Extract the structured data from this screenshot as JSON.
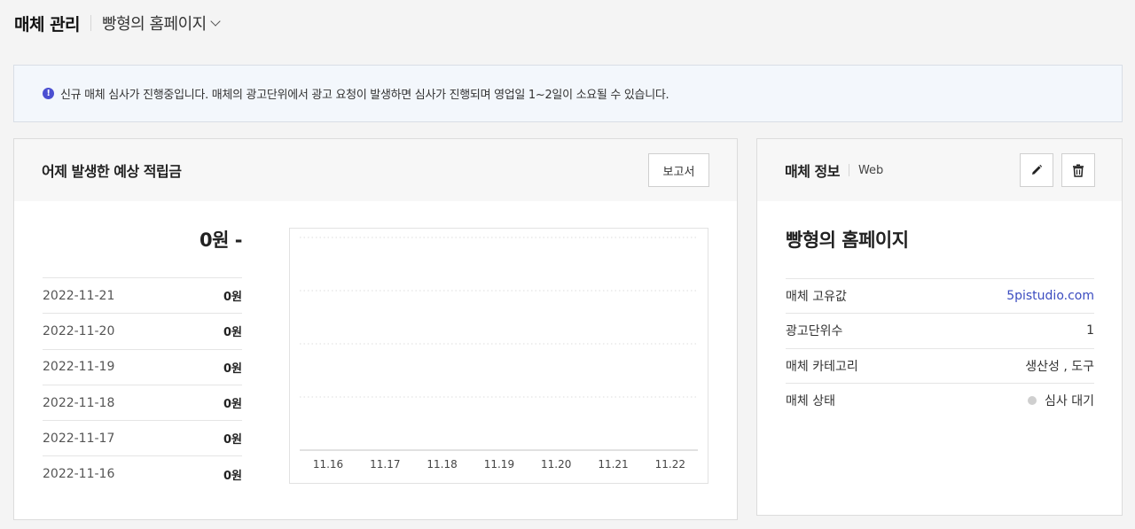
{
  "header": {
    "title": "매체 관리",
    "media_selector": "빵형의 홈페이지"
  },
  "notice": {
    "icon": "exclamation-circle-icon",
    "text": "신규 매체 심사가 진행중입니다. 매체의 광고단위에서 광고 요청이 발생하면 심사가 진행되며 영업일 1~2일이 소요될 수 있습니다.",
    "icon_color": "#4b4fd1"
  },
  "earnings": {
    "title": "어제 발생한 예상 적립금",
    "report_button": "보고서",
    "total": "0원 -",
    "days": [
      {
        "date": "2022-11-21",
        "amount": "0원"
      },
      {
        "date": "2022-11-20",
        "amount": "0원"
      },
      {
        "date": "2022-11-19",
        "amount": "0원"
      },
      {
        "date": "2022-11-18",
        "amount": "0원"
      },
      {
        "date": "2022-11-17",
        "amount": "0원"
      },
      {
        "date": "2022-11-16",
        "amount": "0원"
      }
    ]
  },
  "chart_data": {
    "type": "line",
    "title": "",
    "x": [
      "11.16",
      "11.17",
      "11.18",
      "11.19",
      "11.20",
      "11.21",
      "11.22"
    ],
    "series": [
      {
        "values": [
          0,
          0,
          0,
          0,
          0,
          0,
          0
        ]
      }
    ],
    "xlabel": "",
    "ylabel": "",
    "grid": "horizontal dotted"
  },
  "media_info": {
    "title": "매체 정보",
    "type": "Web",
    "edit_icon": "pencil-icon",
    "delete_icon": "trash-icon",
    "name": "빵형의 홈페이지",
    "rows": [
      {
        "label": "매체 고유값",
        "value": "5pistudio.com"
      },
      {
        "label": "광고단위수",
        "value": "1"
      },
      {
        "label": "매체 카테고리",
        "value": "생산성 , 도구"
      },
      {
        "label": "매체 상태",
        "value": "심사 대기"
      }
    ],
    "link_color": "#3b4cc0",
    "status_dot_color": "#cfcfcf"
  }
}
